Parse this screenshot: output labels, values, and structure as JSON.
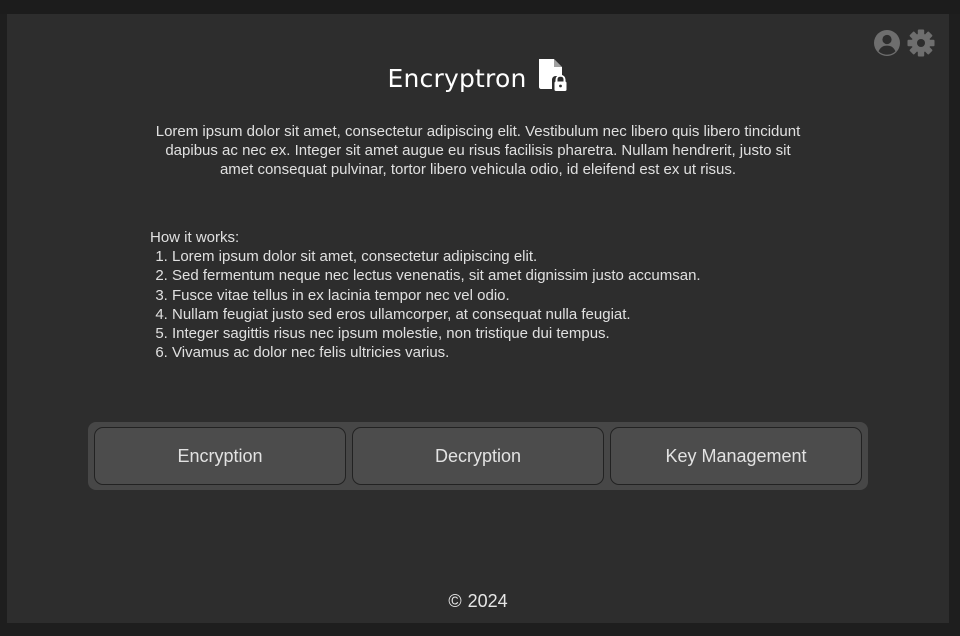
{
  "app": {
    "title": "Encryptron",
    "title_icon": "file-lock-icon"
  },
  "header": {
    "icons": [
      "user-circle-icon",
      "gear-icon"
    ]
  },
  "intro": {
    "text": "Lorem ipsum dolor sit amet, consectetur adipiscing elit. Vestibulum nec libero quis libero tincidunt dapibus ac nec ex. Integer sit amet augue eu risus facilisis pharetra. Nullam hendrerit, justo sit amet consequat pulvinar, tortor libero vehicula odio, id eleifend est ex ut risus."
  },
  "how_it_works": {
    "heading": "How it works:",
    "steps": [
      "Lorem ipsum dolor sit amet, consectetur adipiscing elit.",
      "Sed fermentum neque nec lectus venenatis, sit amet dignissim justo accumsan.",
      "Fusce vitae tellus in ex lacinia tempor nec vel odio.",
      "Nullam feugiat justo sed eros ullamcorper, at consequat nulla feugiat.",
      "Integer sagittis risus nec ipsum molestie, non tristique dui tempus.",
      "Vivamus ac dolor nec felis ultricies varius."
    ]
  },
  "tabs": [
    {
      "label": "Encryption"
    },
    {
      "label": "Decryption"
    },
    {
      "label": "Key Management"
    }
  ],
  "footer": {
    "symbol": "©",
    "year": "2024"
  },
  "colors": {
    "background": "#1e1e1e",
    "panel": "#2d2d2d",
    "tab_bar": "#474747",
    "tab": "#4c4c4c",
    "text": "#e6e6e6"
  }
}
